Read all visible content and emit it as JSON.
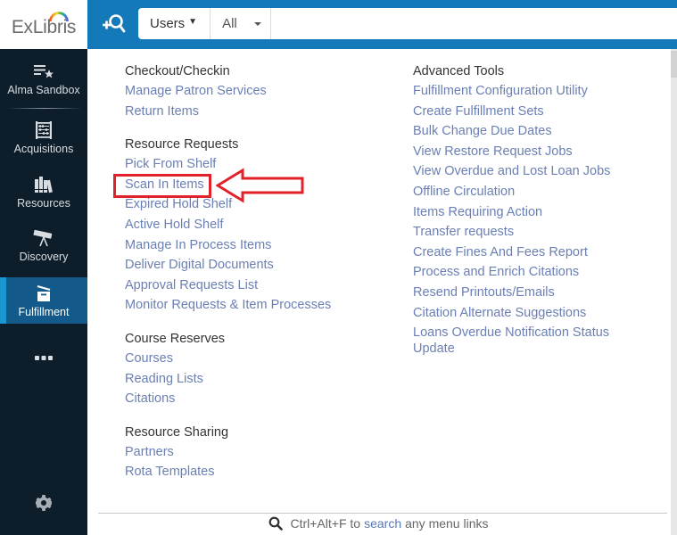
{
  "header": {
    "logo_text": "ExLibris",
    "search_scope": "Users",
    "search_filter": "All",
    "search_placeholder": ""
  },
  "sidebar": {
    "items": [
      {
        "label": "Alma Sandbox",
        "icon": "list-star-icon"
      },
      {
        "label": "Acquisitions",
        "icon": "abacus-icon"
      },
      {
        "label": "Resources",
        "icon": "books-icon"
      },
      {
        "label": "Discovery",
        "icon": "telescope-icon"
      },
      {
        "label": "Fulfillment",
        "icon": "box-open-icon",
        "active": true
      },
      {
        "label": "",
        "icon": "more-dots-icon"
      }
    ],
    "settings_icon": "gear-icon"
  },
  "menu": {
    "left_sections": [
      {
        "title": "Checkout/Checkin",
        "links": [
          "Manage Patron Services",
          "Return Items"
        ]
      },
      {
        "title": "Resource Requests",
        "links": [
          "Pick From Shelf",
          "Scan In Items",
          "Expired Hold Shelf",
          "Active Hold Shelf",
          "Manage In Process Items",
          "Deliver Digital Documents",
          "Approval Requests List",
          "Monitor Requests & Item Processes"
        ]
      },
      {
        "title": "Course Reserves",
        "links": [
          "Courses",
          "Reading Lists",
          "Citations"
        ]
      },
      {
        "title": "Resource Sharing",
        "links": [
          "Partners",
          "Rota Templates"
        ]
      }
    ],
    "right_sections": [
      {
        "title": "Advanced Tools",
        "links": [
          "Fulfillment Configuration Utility",
          "Create Fulfillment Sets",
          "Bulk Change Due Dates",
          "View Restore Request Jobs",
          "View Overdue and Lost Loan Jobs",
          "Offline Circulation",
          "Items Requiring Action",
          "Transfer requests",
          "Create Fines And Fees Report",
          "Process and Enrich Citations",
          "Resend Printouts/Emails",
          "Citation Alternate Suggestions",
          "Loans Overdue Notification Status Update"
        ]
      }
    ],
    "highlighted_link": "Scan In Items"
  },
  "footer": {
    "prefix": "Ctrl+Alt+F to",
    "link": "search",
    "suffix": "any menu links"
  },
  "colors": {
    "topbar": "#1479b8",
    "sidebar": "#0e1d2a",
    "active_item": "#135a8a",
    "link": "#6a7fb4",
    "annotation": "#e2222b"
  }
}
